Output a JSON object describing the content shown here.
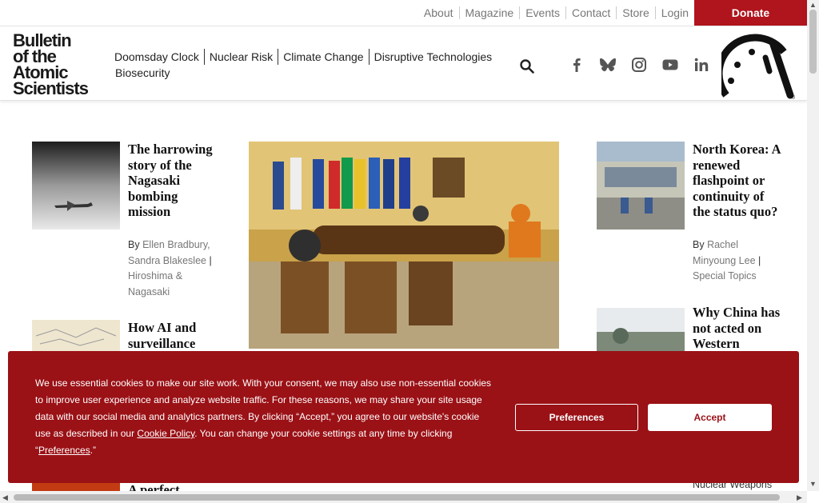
{
  "utility_links": [
    "About",
    "Magazine",
    "Events",
    "Contact",
    "Store",
    "Login"
  ],
  "donate_label": "Donate",
  "logo_lines": [
    "Bulletin",
    "of the",
    "Atomic",
    "Scientists"
  ],
  "nav": {
    "row1": [
      "Doomsday Clock",
      "Nuclear Risk",
      "Climate Change",
      "Disruptive Technologies"
    ],
    "row2": [
      "Biosecurity"
    ]
  },
  "social_icons": [
    "facebook-icon",
    "bluesky-icon",
    "instagram-icon",
    "youtube-icon",
    "linkedin-icon"
  ],
  "articles_left": [
    {
      "title": "The harrowing story of the Nagasaki bombing mission",
      "by": "By",
      "authors": "Ellen Bradbury, Sandra Blakeslee",
      "sep": "|",
      "section": "Hiroshima & Nagasaki"
    },
    {
      "title_partial": "How AI and surveillance"
    },
    {
      "title_partial": "A perfect"
    }
  ],
  "articles_right": [
    {
      "title": "North Korea: A renewed flashpoint or continuity of the status quo?",
      "by": "By",
      "authors": "Rachel Minyoung Lee",
      "sep": "|",
      "section": "Special Topics"
    },
    {
      "title_partial": "Why China has not acted on Western",
      "section_partial": "Nuclear Weapons"
    }
  ],
  "cookie": {
    "text_before": "We use essential cookies to make our site work. With your consent, we may also use non-essential cookies to improve user experience and analyze website traffic. For these reasons, we may share your site usage data with our social media and analytics partners. By clicking “Accept,” you agree to our website's cookie use as described in our ",
    "policy_link": "Cookie Policy",
    "text_middle": ". You can change your cookie settings at any time by clicking “",
    "prefs_link": "Preferences",
    "text_after": ".”",
    "preferences_button": "Preferences",
    "accept_button": "Accept"
  },
  "colors": {
    "brand_red": "#b0141c",
    "cookie_bg": "#9a1116"
  }
}
